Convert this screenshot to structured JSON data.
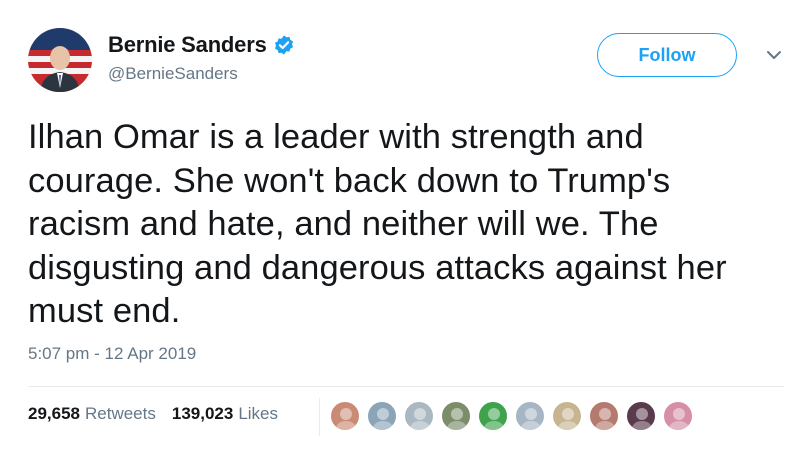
{
  "account": {
    "display_name": "Bernie Sanders",
    "handle": "@BernieSanders",
    "verified": true,
    "avatar_icon": "profile-photo"
  },
  "actions": {
    "follow_label": "Follow",
    "more_icon": "chevron-down-icon"
  },
  "tweet": {
    "lines": [
      "Ilhan Omar is a leader with strength and",
      "courage. She won't back down to Trump's",
      "racism and hate, and neither will we. The",
      "disgusting and dangerous attacks against her",
      "must end."
    ],
    "timestamp": "5:07 pm - 12 Apr 2019"
  },
  "stats": {
    "retweets_count": "29,658",
    "retweets_label": "Retweets",
    "likes_count": "139,023",
    "likes_label": "Likes"
  },
  "likers": [
    {
      "color": "#c98b74"
    },
    {
      "color": "#8aa4b8"
    },
    {
      "color": "#aab8c2"
    },
    {
      "color": "#7c8d6a"
    },
    {
      "color": "#3fa34d"
    },
    {
      "color": "#a7b6c4"
    },
    {
      "color": "#c7b592"
    },
    {
      "color": "#b47a6d"
    },
    {
      "color": "#5a3b4e"
    },
    {
      "color": "#d58fa6"
    }
  ],
  "colors": {
    "accent": "#1da1f2",
    "text": "#14171a",
    "muted": "#657786",
    "divider": "#e6ecf0"
  }
}
